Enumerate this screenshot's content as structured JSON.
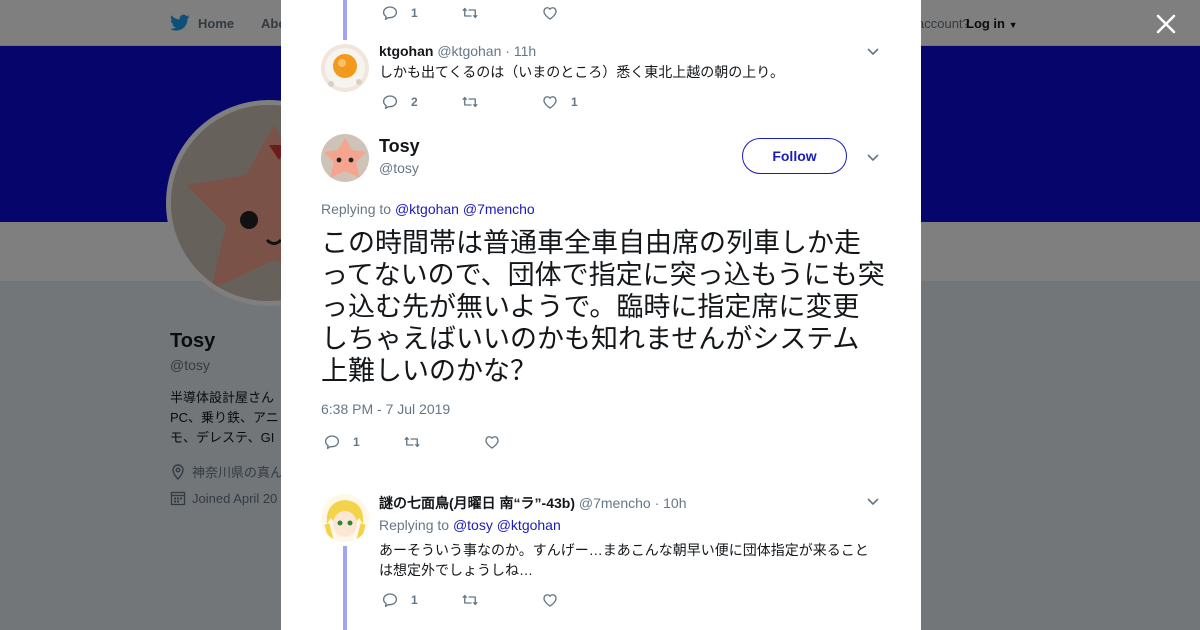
{
  "topbar": {
    "home_label": "Home",
    "about_label": "Abo",
    "account_label": "account?",
    "login_label": "Log in"
  },
  "profile_bg": {
    "name": "Tosy",
    "handle": "@tosy",
    "bio_lines": [
      "半導体設計屋さん",
      "PC、乗り鉄、アニ",
      "モ、デレステ、GI"
    ],
    "location": "神奈川県の真ん",
    "joined": "Joined April 20"
  },
  "thread": {
    "top_actions": {
      "reply_count": "1",
      "retweet_count": "",
      "like_count": ""
    },
    "prev_reply": {
      "name": "ktgohan",
      "handle": "@ktgohan",
      "time": "· 11h",
      "text": "しかも出てくるのは（いまのところ）悉く東北上越の朝の上り。",
      "reply_count": "2",
      "retweet_count": "",
      "like_count": "1"
    },
    "main": {
      "name": "Tosy",
      "handle": "@tosy",
      "follow_label": "Follow",
      "replying_prefix": "Replying to",
      "replying_to": [
        "@ktgohan",
        "@7mencho"
      ],
      "text": "この時間帯は普通車全車自由席の列車しか走ってないので、団体で指定に突っ込もうにも突っ込む先が無いようで。臨時に指定席に変更しちゃえばいいのかも知れませんがシステム上難しいのかな？",
      "timestamp": "6:38 PM - 7 Jul 2019",
      "reply_count": "1",
      "retweet_count": "",
      "like_count": ""
    },
    "next_reply": {
      "name": "謎の七面鳥(月曜日 南“ラ”-43b)",
      "handle": "@7mencho",
      "time": "· 10h",
      "replying_prefix": "Replying to",
      "replying_to": [
        "@tosy",
        "@ktgohan"
      ],
      "text": "あーそういう事なのか。すんげー…まあこんな朝早い便に団体指定が来ることは想定外でしょうしね…",
      "reply_count": "1",
      "retweet_count": "",
      "like_count": ""
    }
  },
  "icons": {
    "brand": "bird-icon",
    "reply": "reply-icon",
    "retweet": "retweet-icon",
    "like": "heart-icon",
    "more": "chevron-down-icon",
    "close": "close-icon",
    "location": "location-pin-icon",
    "calendar": "calendar-icon"
  },
  "colors": {
    "banner": "#0b0bd6",
    "link": "#1b1bb8",
    "thread_line": "#a3a3f5",
    "muted": "#657786"
  }
}
